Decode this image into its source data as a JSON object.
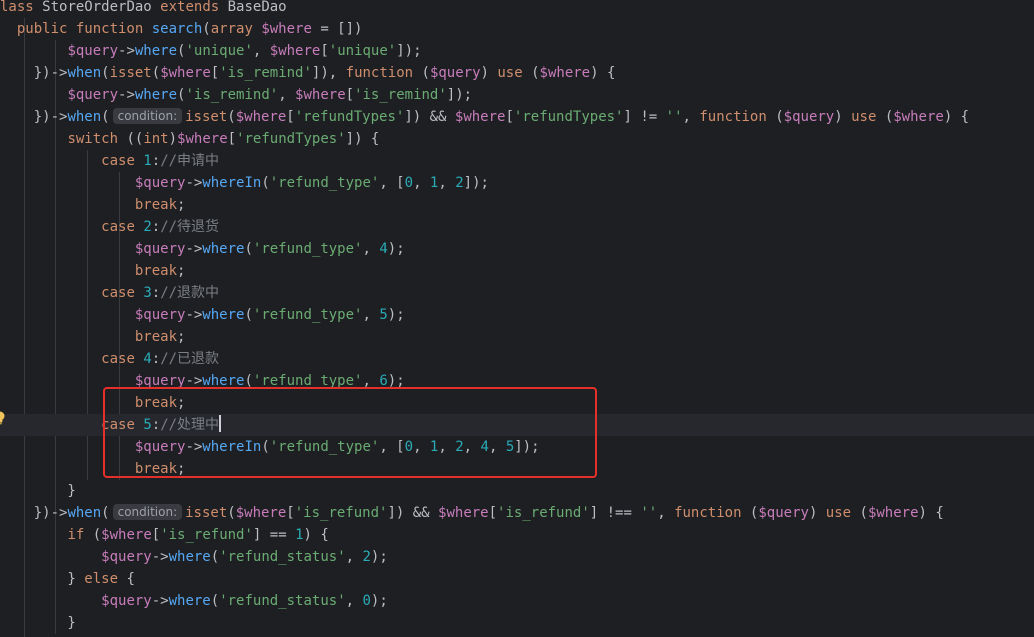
{
  "editor": {
    "lines": [
      {
        "id": "l0",
        "tokens": [
          [
            "kw",
            "lass "
          ],
          [
            "cls",
            "StoreOrderDao "
          ],
          [
            "kw",
            "extends "
          ],
          [
            "cls",
            "BaseDao"
          ]
        ]
      },
      {
        "id": "l1",
        "tokens": [
          [
            "cls",
            "  "
          ],
          [
            "kw",
            "public function "
          ],
          [
            "fn",
            "search"
          ],
          [
            "cls",
            "("
          ],
          [
            "kw",
            "array "
          ],
          [
            "var",
            "$where"
          ],
          [
            "cls",
            " = [])"
          ]
        ]
      },
      {
        "id": "l2",
        "tokens": [
          [
            "cls",
            "        "
          ],
          [
            "var",
            "$query"
          ],
          [
            "cls",
            "->"
          ],
          [
            "fn",
            "where"
          ],
          [
            "cls",
            "("
          ],
          [
            "str",
            "'unique'"
          ],
          [
            "cls",
            ", "
          ],
          [
            "var",
            "$where"
          ],
          [
            "cls",
            "["
          ],
          [
            "str",
            "'unique'"
          ],
          [
            "cls",
            "]);"
          ]
        ]
      },
      {
        "id": "l3",
        "tokens": [
          [
            "cls",
            "    })->"
          ],
          [
            "fn",
            "when"
          ],
          [
            "cls",
            "("
          ],
          [
            "kw",
            "isset"
          ],
          [
            "cls",
            "("
          ],
          [
            "var",
            "$where"
          ],
          [
            "cls",
            "["
          ],
          [
            "str",
            "'is_remind'"
          ],
          [
            "cls",
            "]), "
          ],
          [
            "kw",
            "function "
          ],
          [
            "cls",
            "("
          ],
          [
            "var",
            "$query"
          ],
          [
            "cls",
            ") "
          ],
          [
            "kw",
            "use "
          ],
          [
            "cls",
            "("
          ],
          [
            "var",
            "$where"
          ],
          [
            "cls",
            ") {"
          ]
        ]
      },
      {
        "id": "l4",
        "tokens": [
          [
            "cls",
            "        "
          ],
          [
            "var",
            "$query"
          ],
          [
            "cls",
            "->"
          ],
          [
            "fn",
            "where"
          ],
          [
            "cls",
            "("
          ],
          [
            "str",
            "'is_remind'"
          ],
          [
            "cls",
            ", "
          ],
          [
            "var",
            "$where"
          ],
          [
            "cls",
            "["
          ],
          [
            "str",
            "'is_remind'"
          ],
          [
            "cls",
            "]);"
          ]
        ]
      },
      {
        "id": "l5",
        "tokens": [
          [
            "cls",
            "    })->"
          ],
          [
            "fn",
            "when"
          ],
          [
            "cls",
            "("
          ],
          [
            "hint",
            "condition:"
          ],
          [
            "kw",
            "isset"
          ],
          [
            "cls",
            "("
          ],
          [
            "var",
            "$where"
          ],
          [
            "cls",
            "["
          ],
          [
            "str",
            "'refundTypes'"
          ],
          [
            "cls",
            "]) && "
          ],
          [
            "var",
            "$where"
          ],
          [
            "cls",
            "["
          ],
          [
            "str",
            "'refundTypes'"
          ],
          [
            "cls",
            "] != "
          ],
          [
            "str",
            "''"
          ],
          [
            "cls",
            ", "
          ],
          [
            "kw",
            "function "
          ],
          [
            "cls",
            "("
          ],
          [
            "var",
            "$query"
          ],
          [
            "cls",
            ") "
          ],
          [
            "kw",
            "use "
          ],
          [
            "cls",
            "("
          ],
          [
            "var",
            "$where"
          ],
          [
            "cls",
            ") {"
          ]
        ]
      },
      {
        "id": "l6",
        "tokens": [
          [
            "cls",
            "        "
          ],
          [
            "kw",
            "switch "
          ],
          [
            "cls",
            "(("
          ],
          [
            "kw",
            "int"
          ],
          [
            "cls",
            ")"
          ],
          [
            "var",
            "$where"
          ],
          [
            "cls",
            "["
          ],
          [
            "str",
            "'refundTypes'"
          ],
          [
            "cls",
            "]) {"
          ]
        ]
      },
      {
        "id": "l7",
        "tokens": [
          [
            "cls",
            "            "
          ],
          [
            "kw",
            "case "
          ],
          [
            "num",
            "1"
          ],
          [
            "cls",
            ":"
          ],
          [
            "cm",
            "//申请中"
          ]
        ]
      },
      {
        "id": "l8",
        "tokens": [
          [
            "cls",
            "                "
          ],
          [
            "var",
            "$query"
          ],
          [
            "cls",
            "->"
          ],
          [
            "fn",
            "whereIn"
          ],
          [
            "cls",
            "("
          ],
          [
            "str",
            "'refund_type'"
          ],
          [
            "cls",
            ", ["
          ],
          [
            "num",
            "0"
          ],
          [
            "cls",
            ", "
          ],
          [
            "num",
            "1"
          ],
          [
            "cls",
            ", "
          ],
          [
            "num",
            "2"
          ],
          [
            "cls",
            "]);"
          ]
        ]
      },
      {
        "id": "l9",
        "tokens": [
          [
            "cls",
            "                "
          ],
          [
            "kw",
            "break"
          ],
          [
            "cls",
            ";"
          ]
        ]
      },
      {
        "id": "l10",
        "tokens": [
          [
            "cls",
            "            "
          ],
          [
            "kw",
            "case "
          ],
          [
            "num",
            "2"
          ],
          [
            "cls",
            ":"
          ],
          [
            "cm",
            "//待退货"
          ]
        ]
      },
      {
        "id": "l11",
        "tokens": [
          [
            "cls",
            "                "
          ],
          [
            "var",
            "$query"
          ],
          [
            "cls",
            "->"
          ],
          [
            "fn",
            "where"
          ],
          [
            "cls",
            "("
          ],
          [
            "str",
            "'refund_type'"
          ],
          [
            "cls",
            ", "
          ],
          [
            "num",
            "4"
          ],
          [
            "cls",
            ");"
          ]
        ]
      },
      {
        "id": "l12",
        "tokens": [
          [
            "cls",
            "                "
          ],
          [
            "kw",
            "break"
          ],
          [
            "cls",
            ";"
          ]
        ]
      },
      {
        "id": "l13",
        "tokens": [
          [
            "cls",
            "            "
          ],
          [
            "kw",
            "case "
          ],
          [
            "num",
            "3"
          ],
          [
            "cls",
            ":"
          ],
          [
            "cm",
            "//退款中"
          ]
        ]
      },
      {
        "id": "l14",
        "tokens": [
          [
            "cls",
            "                "
          ],
          [
            "var",
            "$query"
          ],
          [
            "cls",
            "->"
          ],
          [
            "fn",
            "where"
          ],
          [
            "cls",
            "("
          ],
          [
            "str",
            "'refund_type'"
          ],
          [
            "cls",
            ", "
          ],
          [
            "num",
            "5"
          ],
          [
            "cls",
            ");"
          ]
        ]
      },
      {
        "id": "l15",
        "tokens": [
          [
            "cls",
            "                "
          ],
          [
            "kw",
            "break"
          ],
          [
            "cls",
            ";"
          ]
        ]
      },
      {
        "id": "l16",
        "tokens": [
          [
            "cls",
            "            "
          ],
          [
            "kw",
            "case "
          ],
          [
            "num",
            "4"
          ],
          [
            "cls",
            ":"
          ],
          [
            "cm",
            "//已退款"
          ]
        ]
      },
      {
        "id": "l17",
        "tokens": [
          [
            "cls",
            "                "
          ],
          [
            "var",
            "$query"
          ],
          [
            "cls",
            "->"
          ],
          [
            "fn",
            "where"
          ],
          [
            "cls",
            "("
          ],
          [
            "str",
            "'refund_type'"
          ],
          [
            "cls",
            ", "
          ],
          [
            "num",
            "6"
          ],
          [
            "cls",
            ");"
          ]
        ]
      },
      {
        "id": "l18",
        "tokens": [
          [
            "cls",
            "                "
          ],
          [
            "kw",
            "break"
          ],
          [
            "cls",
            ";"
          ]
        ]
      },
      {
        "id": "l19",
        "tokens": [
          [
            "cls",
            "            "
          ],
          [
            "kw",
            "case "
          ],
          [
            "num",
            "5"
          ],
          [
            "cls",
            ":"
          ],
          [
            "cm",
            "//处理中"
          ],
          [
            "caret",
            ""
          ]
        ],
        "current": true
      },
      {
        "id": "l20",
        "tokens": [
          [
            "cls",
            "                "
          ],
          [
            "var",
            "$query"
          ],
          [
            "cls",
            "->"
          ],
          [
            "fn",
            "whereIn"
          ],
          [
            "cls",
            "("
          ],
          [
            "str",
            "'refund_type'"
          ],
          [
            "cls",
            ", ["
          ],
          [
            "num",
            "0"
          ],
          [
            "cls",
            ", "
          ],
          [
            "num",
            "1"
          ],
          [
            "cls",
            ", "
          ],
          [
            "num",
            "2"
          ],
          [
            "cls",
            ", "
          ],
          [
            "num",
            "4"
          ],
          [
            "cls",
            ", "
          ],
          [
            "num",
            "5"
          ],
          [
            "cls",
            "]);"
          ]
        ]
      },
      {
        "id": "l21",
        "tokens": [
          [
            "cls",
            "                "
          ],
          [
            "kw",
            "break"
          ],
          [
            "cls",
            ";"
          ]
        ]
      },
      {
        "id": "l22",
        "tokens": [
          [
            "cls",
            "        }"
          ]
        ]
      },
      {
        "id": "l23",
        "tokens": [
          [
            "cls",
            "    })->"
          ],
          [
            "fn",
            "when"
          ],
          [
            "cls",
            "("
          ],
          [
            "hint",
            "condition:"
          ],
          [
            "kw",
            "isset"
          ],
          [
            "cls",
            "("
          ],
          [
            "var",
            "$where"
          ],
          [
            "cls",
            "["
          ],
          [
            "str",
            "'is_refund'"
          ],
          [
            "cls",
            "]) && "
          ],
          [
            "var",
            "$where"
          ],
          [
            "cls",
            "["
          ],
          [
            "str",
            "'is_refund'"
          ],
          [
            "cls",
            "] !== "
          ],
          [
            "str",
            "''"
          ],
          [
            "cls",
            ", "
          ],
          [
            "kw",
            "function "
          ],
          [
            "cls",
            "("
          ],
          [
            "var",
            "$query"
          ],
          [
            "cls",
            ") "
          ],
          [
            "kw",
            "use "
          ],
          [
            "cls",
            "("
          ],
          [
            "var",
            "$where"
          ],
          [
            "cls",
            ") {"
          ]
        ]
      },
      {
        "id": "l24",
        "tokens": [
          [
            "cls",
            "        "
          ],
          [
            "kw",
            "if "
          ],
          [
            "cls",
            "("
          ],
          [
            "var",
            "$where"
          ],
          [
            "cls",
            "["
          ],
          [
            "str",
            "'is_refund'"
          ],
          [
            "cls",
            "] == "
          ],
          [
            "num",
            "1"
          ],
          [
            "cls",
            ") {"
          ]
        ]
      },
      {
        "id": "l25",
        "tokens": [
          [
            "cls",
            "            "
          ],
          [
            "var",
            "$query"
          ],
          [
            "cls",
            "->"
          ],
          [
            "fn",
            "where"
          ],
          [
            "cls",
            "("
          ],
          [
            "str",
            "'refund_status'"
          ],
          [
            "cls",
            ", "
          ],
          [
            "num",
            "2"
          ],
          [
            "cls",
            ");"
          ]
        ]
      },
      {
        "id": "l26",
        "tokens": [
          [
            "cls",
            "        } "
          ],
          [
            "kw",
            "else "
          ],
          [
            "cls",
            "{"
          ]
        ]
      },
      {
        "id": "l27",
        "tokens": [
          [
            "cls",
            "            "
          ],
          [
            "var",
            "$query"
          ],
          [
            "cls",
            "->"
          ],
          [
            "fn",
            "where"
          ],
          [
            "cls",
            "("
          ],
          [
            "str",
            "'refund_status'"
          ],
          [
            "cls",
            ", "
          ],
          [
            "num",
            "0"
          ],
          [
            "cls",
            ");"
          ]
        ]
      },
      {
        "id": "l28",
        "tokens": [
          [
            "cls",
            "        }"
          ]
        ]
      },
      {
        "id": "l29",
        "tokens": [
          [
            "cls",
            "    })"
          ]
        ]
      }
    ]
  },
  "colors": {
    "background": "#1e1f22",
    "keyword": "#cf8e6d",
    "variable": "#c77dbb",
    "string": "#6aab73",
    "number": "#2aacb8",
    "function": "#56a8f5",
    "comment": "#7a7e85",
    "highlight_box": "#e3302a"
  },
  "icons": {
    "gutter_bulb": "lightbulb-icon"
  }
}
